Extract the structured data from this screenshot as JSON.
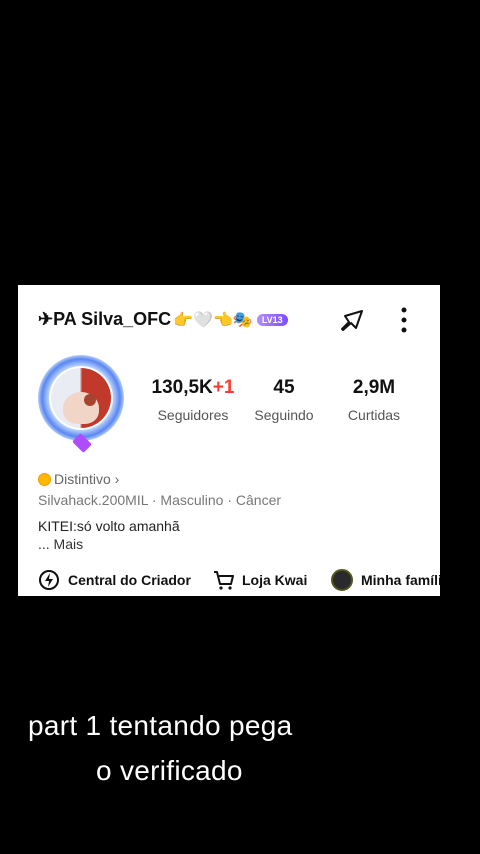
{
  "profile": {
    "username": "✈PA Silva_OFC",
    "username_emojis": "👉🤍👈🎭",
    "level_badge": "LV13",
    "stats": {
      "followers_value": "130,5K",
      "followers_delta": "+1",
      "followers_label": "Seguidores",
      "following_value": "45",
      "following_label": "Seguindo",
      "likes_value": "2,9M",
      "likes_label": "Curtidas"
    },
    "badge_label": "Distintivo ›",
    "info": "Silvahack.200MIL · Masculino · Câncer",
    "bio": "KITEI:só volto amanhã",
    "more": "... Mais"
  },
  "actions": {
    "creator": "Central do Criador",
    "shop": "Loja Kwai",
    "family": "Minha famíli"
  },
  "overlay": {
    "line1": "part 1 tentando pega",
    "line2": "o verificado"
  },
  "colors": {
    "accent_red": "#ff3b2f",
    "level_purple": "#7c4dff",
    "coin": "#ffb800"
  }
}
